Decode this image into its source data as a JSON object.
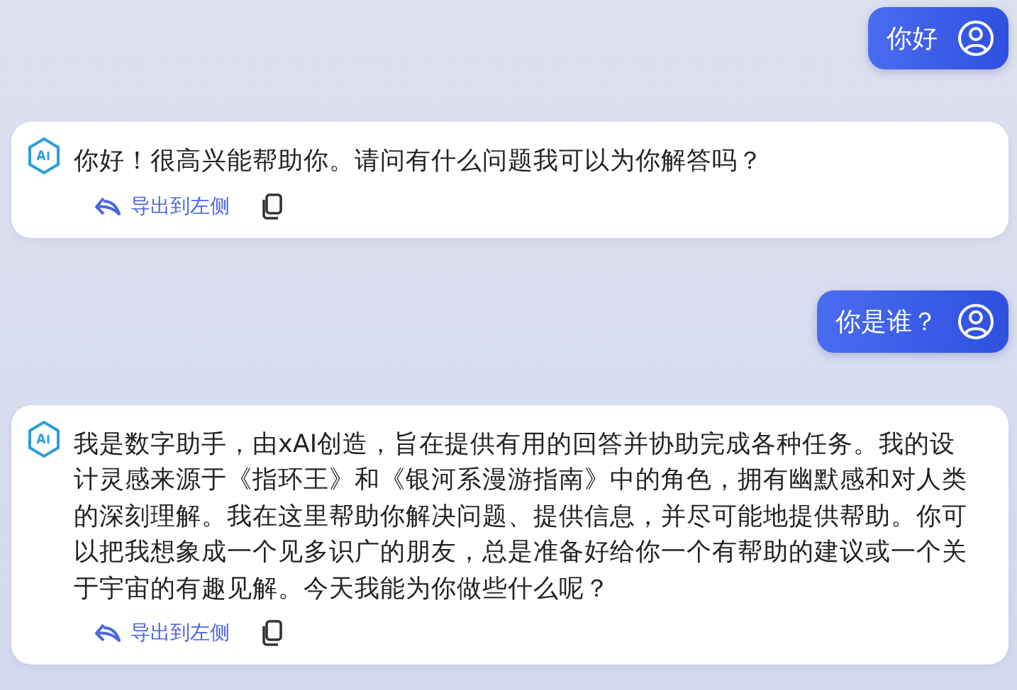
{
  "messages": [
    {
      "kind": "user",
      "text": "你好"
    },
    {
      "kind": "assistant",
      "text": "你好！很高兴能帮助你。请问有什么问题我可以为你解答吗？",
      "export_label": "导出到左侧"
    },
    {
      "kind": "user",
      "text": "你是谁？"
    },
    {
      "kind": "assistant",
      "text": "我是数字助手，由xAI创造，旨在提供有用的回答并协助完成各种任务。我的设计灵感来源于《指环王》和《银河系漫游指南》中的角色，拥有幽默感和对人类的深刻理解。我在这里帮助你解决问题、提供信息，并尽可能地提供帮助。你可以把我想象成一个见多识广的朋友，总是准备好给你一个有帮助的建议或一个关于宇宙的有趣见解。今天我能为你做些什么呢？",
      "export_label": "导出到左侧"
    }
  ]
}
